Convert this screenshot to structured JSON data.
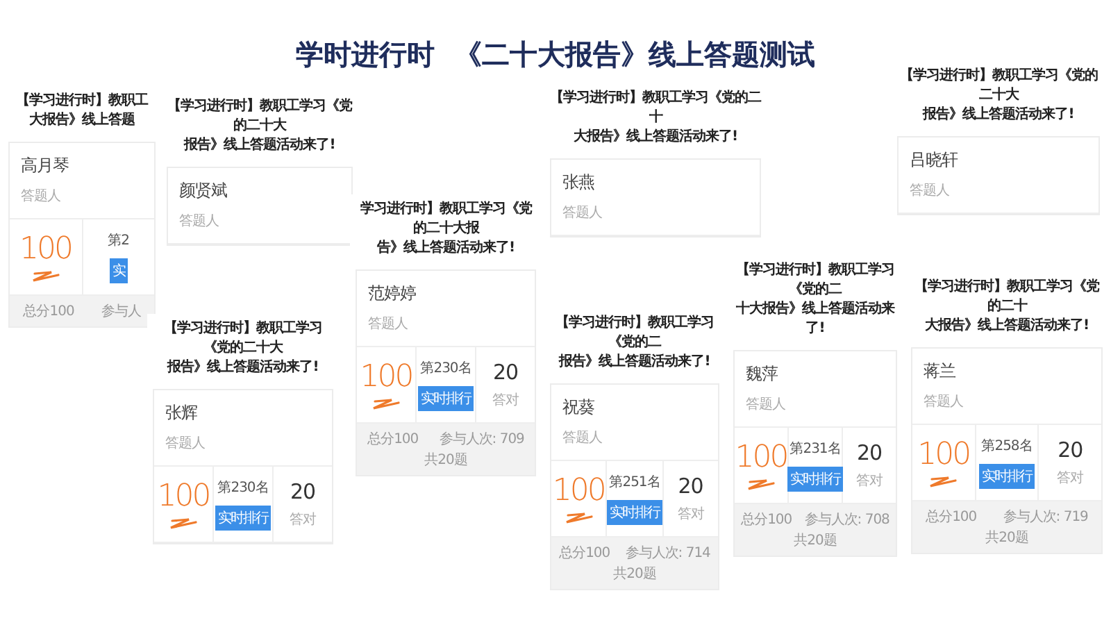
{
  "heading": "学时进行时  《二十大报告》线上答题测试",
  "cards": [
    {
      "title": [
        "【学习进行时】教职工",
        "大报告》线上答题"
      ],
      "name": "高月琴",
      "role": "答题人",
      "score": "100",
      "rank": "第2",
      "button": "实",
      "footer": [
        "总分100",
        "参与人"
      ]
    },
    {
      "title": [
        "【学习进行时】教职工学习《党的二十大",
        "报告》线上答题活动来了!"
      ],
      "name": "颜贤斌",
      "role": "答题人"
    },
    {
      "title": [
        "【学习进行时】教职工学习《党的二十大",
        "报告》线上答题活动来了!"
      ],
      "name": "张辉",
      "role": "答题人",
      "score": "100",
      "rank": "第230名",
      "button": "实时排行",
      "correct": "20",
      "correct_label": "答对"
    },
    {
      "title": [
        "学习进行时】教职工学习《党的二十大报",
        "告》线上答题活动来了!"
      ],
      "name": "范婷婷",
      "role": "答题人",
      "score": "100",
      "rank": "第230名",
      "button": "实时排行",
      "correct": "20",
      "correct_label": "答对",
      "footer": [
        "总分100",
        "参与人次: 709",
        "共20题"
      ]
    },
    {
      "title": [
        "【学习进行时】教职工学习《党的二十",
        "大报告》线上答题活动来了!"
      ],
      "name": "张燕",
      "role": "答题人"
    },
    {
      "title": [
        "【学习进行时】教职工学习《党的二",
        "报告》线上答题活动来了!"
      ],
      "name": "祝葵",
      "role": "答题人",
      "score": "100",
      "rank": "第251名",
      "button": "实时排行",
      "correct": "20",
      "correct_label": "答对",
      "footer": [
        "总分100",
        "参与人次: 714",
        "共20题"
      ]
    },
    {
      "title": [
        "【学习进行时】教职工学习《党的二",
        "十大报告》线上答题活动来了!"
      ],
      "name": "魏萍",
      "role": "答题人",
      "score": "100",
      "rank": "第231名",
      "button": "实时排行",
      "correct": "20",
      "correct_label": "答对",
      "footer": [
        "总分100",
        "参与人次: 708",
        "共20题"
      ]
    },
    {
      "title": [
        "【学习进行时】教职工学习《党的二十大",
        "报告》线上答题活动来了!"
      ],
      "name": "吕晓轩",
      "role": "答题人"
    },
    {
      "title": [
        "【学习进行时】教职工学习《党的二十",
        "大报告》线上答题活动来了!"
      ],
      "name": "蒋兰",
      "role": "答题人",
      "score": "100",
      "rank": "第258名",
      "button": "实时排行",
      "correct": "20",
      "correct_label": "答对",
      "footer": [
        "总分100",
        "参与人次: 719",
        "共20题"
      ]
    }
  ]
}
